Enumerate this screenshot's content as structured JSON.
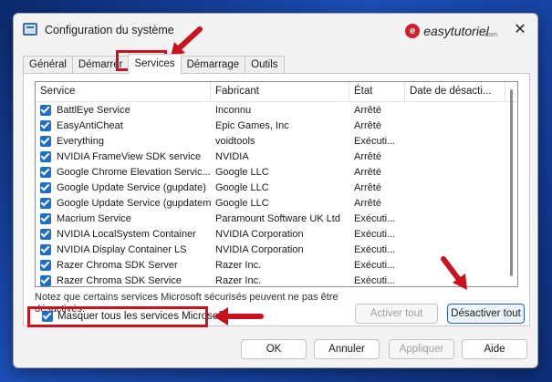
{
  "window": {
    "title": "Configuration du système",
    "brand": {
      "logo": "e",
      "text": "easytutoriel",
      "suffix": ".com"
    },
    "close_glyph": "✕"
  },
  "tabs": [
    {
      "label": "Général",
      "active": false
    },
    {
      "label": "Démarrer",
      "active": false
    },
    {
      "label": "Services",
      "active": true
    },
    {
      "label": "Démarrage",
      "active": false
    },
    {
      "label": "Outils",
      "active": false
    }
  ],
  "table": {
    "columns": [
      "Service",
      "Fabricant",
      "État",
      "Date de désacti..."
    ],
    "rows": [
      {
        "service": "BattlEye Service",
        "maker": "Inconnu",
        "state": "Arrêté",
        "date": "",
        "checked": true
      },
      {
        "service": "EasyAntiCheat",
        "maker": "Epic Games, Inc",
        "state": "Arrêté",
        "date": "",
        "checked": true
      },
      {
        "service": "Everything",
        "maker": "voidtools",
        "state": "Exécuti...",
        "date": "",
        "checked": true
      },
      {
        "service": "NVIDIA FrameView SDK service",
        "maker": "NVIDIA",
        "state": "Arrêté",
        "date": "",
        "checked": true
      },
      {
        "service": "Google Chrome Elevation Servic...",
        "maker": "Google LLC",
        "state": "Arrêté",
        "date": "",
        "checked": true
      },
      {
        "service": "Google Update Service (gupdate)",
        "maker": "Google LLC",
        "state": "Arrêté",
        "date": "",
        "checked": true
      },
      {
        "service": "Google Update Service (gupdatem)",
        "maker": "Google LLC",
        "state": "Arrêté",
        "date": "",
        "checked": true
      },
      {
        "service": "Macrium Service",
        "maker": "Paramount Software UK Ltd",
        "state": "Exécuti...",
        "date": "",
        "checked": true
      },
      {
        "service": "NVIDIA LocalSystem Container",
        "maker": "NVIDIA Corporation",
        "state": "Exécuti...",
        "date": "",
        "checked": true
      },
      {
        "service": "NVIDIA Display Container LS",
        "maker": "NVIDIA Corporation",
        "state": "Exécuti...",
        "date": "",
        "checked": true
      },
      {
        "service": "Razer Chroma SDK Server",
        "maker": "Razer Inc.",
        "state": "Exécuti...",
        "date": "",
        "checked": true
      },
      {
        "service": "Razer Chroma SDK Service",
        "maker": "Razer Inc.",
        "state": "Exécuti...",
        "date": "",
        "checked": true
      }
    ]
  },
  "note": "Notez que certains services Microsoft sécurisés peuvent ne pas être désactivés.",
  "buttons": {
    "enable_all": "Activer tout",
    "disable_all": "Désactiver tout",
    "ok": "OK",
    "cancel": "Annuler",
    "apply": "Appliquer",
    "help": "Aide"
  },
  "hide_ms": {
    "label": "Masquer tous les services Microsoft",
    "checked": true
  },
  "annotation_color": "#c9121d"
}
